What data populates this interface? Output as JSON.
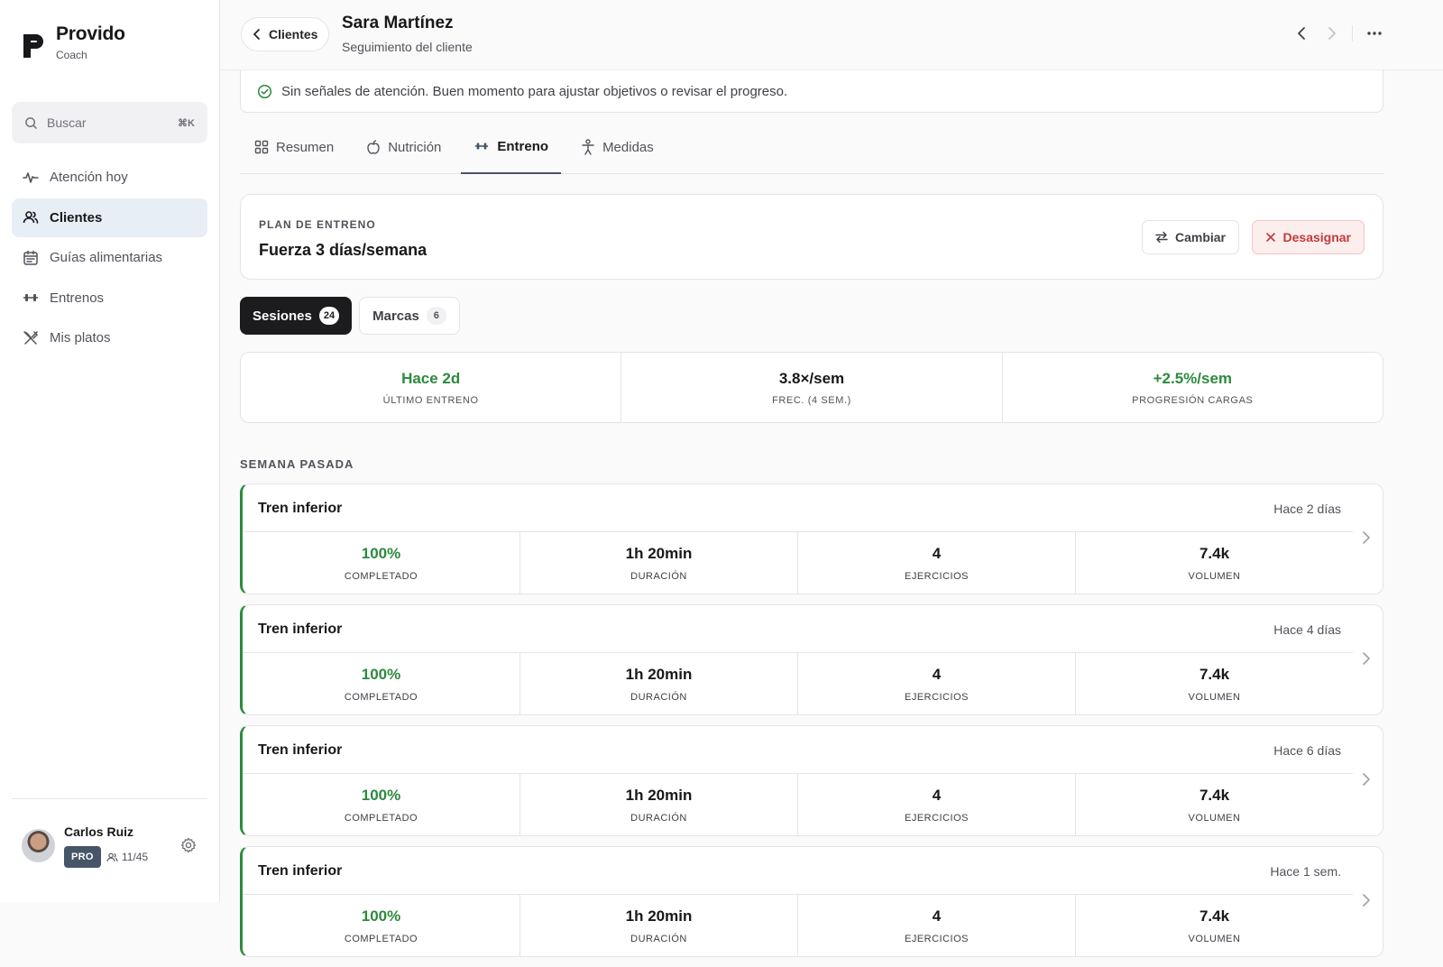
{
  "app": {
    "name": "Provido",
    "subtitle": "Coach"
  },
  "search": {
    "placeholder": "Buscar",
    "shortcut": "⌘K"
  },
  "nav": [
    {
      "label": "Atención hoy",
      "icon": "activity-icon",
      "active": false
    },
    {
      "label": "Clientes",
      "icon": "users-icon",
      "active": true
    },
    {
      "label": "Guías alimentarias",
      "icon": "calendar-icon",
      "active": false
    },
    {
      "label": "Entrenos",
      "icon": "dumbbell-icon",
      "active": false
    },
    {
      "label": "Mis platos",
      "icon": "utensils-icon",
      "active": false
    }
  ],
  "user": {
    "name": "Carlos Ruiz",
    "plan": "PRO",
    "clients": "11/45"
  },
  "header": {
    "back_label": "Clientes",
    "client_name": "Sara Martínez",
    "client_subtitle": "Seguimiento del cliente"
  },
  "alert": {
    "text": "Sin señales de atención. Buen momento para ajustar objetivos o revisar el progreso."
  },
  "tabs": [
    {
      "label": "Resumen",
      "active": false
    },
    {
      "label": "Nutrición",
      "active": false
    },
    {
      "label": "Entreno",
      "active": true
    },
    {
      "label": "Medidas",
      "active": false
    }
  ],
  "plan": {
    "label": "PLAN DE ENTRENO",
    "name": "Fuerza 3 días/semana",
    "change_label": "Cambiar",
    "unassign_label": "Desasignar"
  },
  "segments": [
    {
      "label": "Sesiones",
      "count": "24",
      "active": true
    },
    {
      "label": "Marcas",
      "count": "6",
      "active": false
    }
  ],
  "stats": [
    {
      "value": "Hace 2d",
      "label": "ÚLTIMO ENTRENO",
      "color": "#2d8a3e"
    },
    {
      "value": "3.8×/sem",
      "label": "FREC. (4 SEM.)",
      "color": "#18181b"
    },
    {
      "value": "+2.5%/sem",
      "label": "PROGRESIÓN CARGAS",
      "color": "#2d8a3e"
    }
  ],
  "section": {
    "title": "SEMANA PASADA"
  },
  "sessions": [
    {
      "title": "Tren inferior",
      "date": "Hace 2 días",
      "completed": "100%",
      "duration": "1h 20min",
      "exercises": "4",
      "volume": "7.4k"
    },
    {
      "title": "Tren inferior",
      "date": "Hace 4 días",
      "completed": "100%",
      "duration": "1h 20min",
      "exercises": "4",
      "volume": "7.4k"
    },
    {
      "title": "Tren inferior",
      "date": "Hace 6 días",
      "completed": "100%",
      "duration": "1h 20min",
      "exercises": "4",
      "volume": "7.4k"
    },
    {
      "title": "Tren inferior",
      "date": "Hace 1 sem.",
      "completed": "100%",
      "duration": "1h 20min",
      "exercises": "4",
      "volume": "7.4k"
    }
  ],
  "metric_labels": {
    "completed": "COMPLETADO",
    "duration": "DURACIÓN",
    "exercises": "EJERCICIOS",
    "volume": "VOLUMEN"
  },
  "colors": {
    "accent_green": "#2d8a3e",
    "danger": "#c23a3a",
    "nav_active_bg": "#e8eef6"
  }
}
